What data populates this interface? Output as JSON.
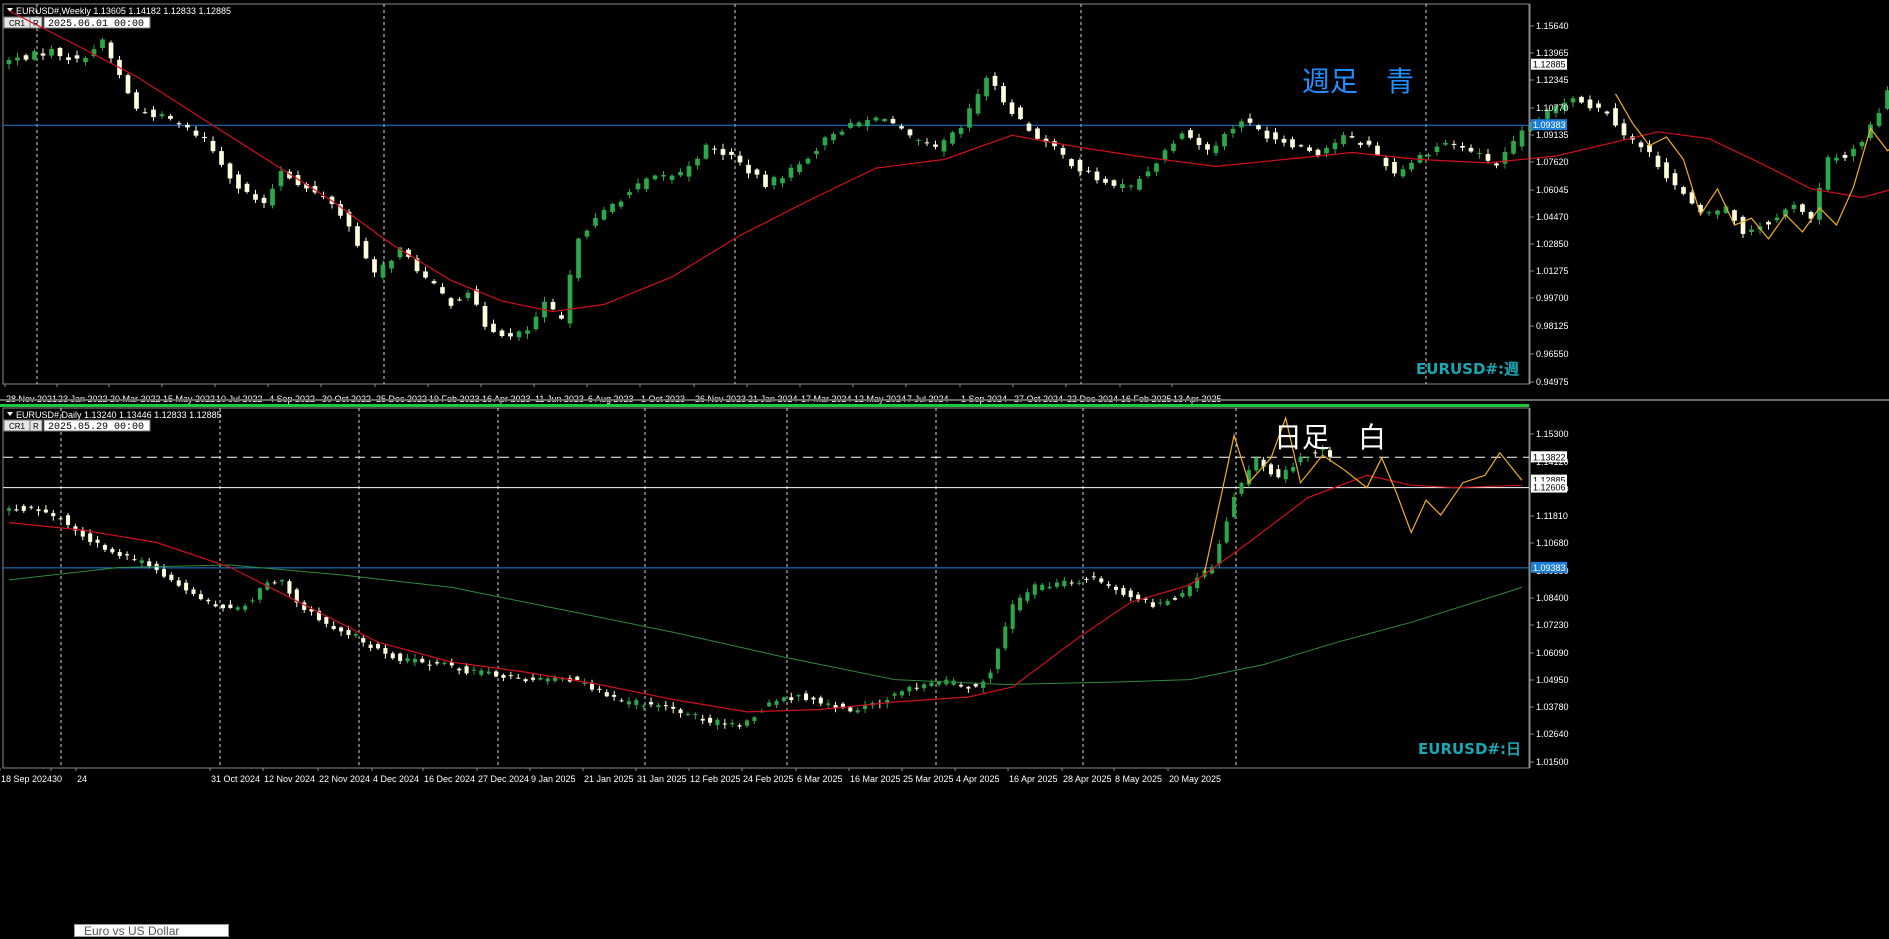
{
  "colors": {
    "background": "#000000",
    "bull_body": "#2ca84a",
    "bear_body": "#ffffe0",
    "ma_red": "#d0101a",
    "ma_green": "#2f8a3a",
    "zigzag": "#f0b020",
    "hline_blue": "#1e7fd8",
    "frame": "#8a8a8a",
    "annotation_blue": "#1e90ff",
    "watermark": "#1aa6b4",
    "active_border": "#1fc83a"
  },
  "panels": [
    {
      "header": {
        "symbol": "EURUSD#,Weekly",
        "ohlc": "1.13605 1.14182 1.12833 1.12885",
        "cr_label": "CR1",
        "r_label": "R",
        "datetime": "2025.06.01 00:00"
      },
      "annotation": "週足　青",
      "watermark": "EURUSD#:週",
      "price_ticks": [
        "1.15640",
        "1.13965",
        "1.12345",
        "1.10770",
        "1.09135",
        "1.07620",
        "1.06045",
        "1.04470",
        "1.02850",
        "1.01275",
        "0.99700",
        "0.98125",
        "0.96550",
        "0.94975"
      ],
      "time_ticks": [
        "28 Nov 2021",
        "23 Jan 2022",
        "20 Mar 2022",
        "15 May 2022",
        "10 Jul 2022",
        "4 Sep 2022",
        "30 Oct 2022",
        "25 Dec 2022",
        "19 Feb 2023",
        "16 Apr 2023",
        "11 Jun 2023",
        "6 Aug 2023",
        "1 Oct 2023",
        "26 Nov 2023",
        "21 Jan 2024",
        "17 Mar 2024",
        "12 May 2024",
        "7 Jul 2024",
        "1 Sep 2024",
        "27 Oct 2024",
        "22 Dec 2024",
        "16 Feb 2025",
        "13 Apr 2025"
      ],
      "price_labels": [
        {
          "text": "1.12885",
          "value": 1.12885,
          "style": "white"
        },
        {
          "text": "1.09383",
          "value": 1.09383,
          "style": "blue"
        }
      ],
      "hlines": [
        {
          "value": 1.09383,
          "style": "blue"
        }
      ]
    },
    {
      "header": {
        "symbol": "EURUSD#,Daily",
        "ohlc": "1.13240 1.13446 1.12833 1.12885",
        "cr_label": "CR1",
        "r_label": "R",
        "datetime": "2025.05.29 00:00"
      },
      "annotation": "日足　白",
      "watermark": "EURUSD#:日",
      "footer_label": "Euro vs US Dollar",
      "price_ticks": [
        "1.15300",
        "1.14120",
        "1.12940",
        "1.11810",
        "1.10680",
        "1.09550",
        "1.08400",
        "1.07230",
        "1.06090",
        "1.04950",
        "1.03780",
        "1.02640",
        "1.01500"
      ],
      "time_ticks": [
        "18 Sep 2024",
        "30",
        "24",
        "31 Oct 2024",
        "12 Nov 2024",
        "22 Nov 2024",
        "4 Dec 2024",
        "16 Dec 2024",
        "27 Dec 2024",
        "9 Jan 2025",
        "21 Jan 2025",
        "31 Jan 2025",
        "12 Feb 2025",
        "24 Feb 2025",
        "6 Mar 2025",
        "16 Mar 2025",
        "25 Mar 2025",
        "4 Apr 2025",
        "16 Apr 2025",
        "28 Apr 2025",
        "8 May 2025",
        "20 May 2025"
      ],
      "price_labels": [
        {
          "text": "1.13822",
          "value": 1.13822,
          "style": "white"
        },
        {
          "text": "1.12885",
          "value": 1.12885,
          "style": "white"
        },
        {
          "text": "1.12606",
          "value": 1.12606,
          "style": "white"
        },
        {
          "text": "1.09383",
          "value": 1.09383,
          "style": "blue"
        }
      ],
      "hlines": [
        {
          "value": 1.13822,
          "style": "white-dashed"
        },
        {
          "value": 1.12606,
          "style": "white"
        },
        {
          "value": 1.09383,
          "style": "blue"
        }
      ]
    }
  ],
  "chart_data": [
    {
      "type": "candlestick",
      "title": "EURUSD#,Weekly",
      "ylim": [
        0.944,
        1.164
      ],
      "x_start": "28 Nov 2021",
      "bar_count": 222,
      "grid": "vertical dashed",
      "close_path": [
        [
          0,
          1.13
        ],
        [
          6,
          1.137
        ],
        [
          9,
          1.131
        ],
        [
          12,
          1.142
        ],
        [
          16,
          1.103
        ],
        [
          20,
          1.097
        ],
        [
          24,
          1.086
        ],
        [
          28,
          1.058
        ],
        [
          31,
          1.047
        ],
        [
          33,
          1.068
        ],
        [
          36,
          1.057
        ],
        [
          39,
          1.049
        ],
        [
          41,
          1.035
        ],
        [
          44,
          1.007
        ],
        [
          47,
          1.022
        ],
        [
          50,
          1.005
        ],
        [
          53,
          0.991
        ],
        [
          55,
          0.998
        ],
        [
          57,
          0.978
        ],
        [
          60,
          0.971
        ],
        [
          62,
          0.975
        ],
        [
          64,
          0.99
        ],
        [
          66,
          0.981
        ],
        [
          68,
          1.03
        ],
        [
          72,
          1.048
        ],
        [
          76,
          1.062
        ],
        [
          80,
          1.066
        ],
        [
          83,
          1.081
        ],
        [
          86,
          1.076
        ],
        [
          90,
          1.059
        ],
        [
          94,
          1.071
        ],
        [
          98,
          1.09
        ],
        [
          101,
          1.095
        ],
        [
          104,
          1.099
        ],
        [
          107,
          1.086
        ],
        [
          110,
          1.08
        ],
        [
          113,
          1.092
        ],
        [
          116,
          1.122
        ],
        [
          118,
          1.108
        ],
        [
          121,
          1.091
        ],
        [
          124,
          1.08
        ],
        [
          127,
          1.068
        ],
        [
          130,
          1.06
        ],
        [
          133,
          1.058
        ],
        [
          136,
          1.073
        ],
        [
          139,
          1.091
        ],
        [
          142,
          1.079
        ],
        [
          146,
          1.097
        ],
        [
          149,
          1.088
        ],
        [
          152,
          1.083
        ],
        [
          155,
          1.078
        ],
        [
          158,
          1.087
        ],
        [
          161,
          1.082
        ],
        [
          164,
          1.066
        ],
        [
          167,
          1.076
        ],
        [
          170,
          1.084
        ],
        [
          173,
          1.079
        ],
        [
          176,
          1.071
        ],
        [
          179,
          1.089
        ],
        [
          182,
          1.101
        ],
        [
          185,
          1.111
        ],
        [
          187,
          1.105
        ],
        [
          189,
          1.102
        ],
        [
          191,
          1.089
        ],
        [
          194,
          1.077
        ],
        [
          197,
          1.059
        ],
        [
          200,
          1.042
        ],
        [
          203,
          1.046
        ],
        [
          205,
          1.032
        ],
        [
          207,
          1.036
        ],
        [
          209,
          1.04
        ],
        [
          211,
          1.049
        ],
        [
          213,
          1.039
        ],
        [
          215,
          1.074
        ],
        [
          217,
          1.076
        ],
        [
          219,
          1.085
        ],
        [
          221,
          1.102
        ],
        [
          223,
          1.128
        ],
        [
          225,
          1.147
        ],
        [
          227,
          1.133
        ],
        [
          229,
          1.125
        ],
        [
          231,
          1.129
        ]
      ],
      "ma_red": [
        [
          0,
          1.16
        ],
        [
          8,
          1.14
        ],
        [
          15,
          1.122
        ],
        [
          22,
          1.1
        ],
        [
          30,
          1.075
        ],
        [
          38,
          1.05
        ],
        [
          45,
          1.025
        ],
        [
          52,
          1.004
        ],
        [
          58,
          0.992
        ],
        [
          64,
          0.986
        ],
        [
          70,
          0.99
        ],
        [
          78,
          1.006
        ],
        [
          86,
          1.03
        ],
        [
          94,
          1.05
        ],
        [
          102,
          1.069
        ],
        [
          110,
          1.074
        ],
        [
          118,
          1.088
        ],
        [
          126,
          1.081
        ],
        [
          134,
          1.075
        ],
        [
          142,
          1.07
        ],
        [
          150,
          1.074
        ],
        [
          158,
          1.078
        ],
        [
          166,
          1.074
        ],
        [
          174,
          1.072
        ],
        [
          182,
          1.076
        ],
        [
          188,
          1.083
        ],
        [
          194,
          1.09
        ],
        [
          200,
          1.086
        ],
        [
          206,
          1.072
        ],
        [
          212,
          1.057
        ],
        [
          218,
          1.052
        ],
        [
          224,
          1.06
        ],
        [
          231,
          1.077
        ]
      ],
      "zigzag": [
        [
          189,
          1.112
        ],
        [
          191,
          1.095
        ],
        [
          193,
          1.082
        ],
        [
          195,
          1.087
        ],
        [
          197,
          1.074
        ],
        [
          199,
          1.042
        ],
        [
          201,
          1.057
        ],
        [
          203,
          1.036
        ],
        [
          205,
          1.04
        ],
        [
          207,
          1.028
        ],
        [
          209,
          1.042
        ],
        [
          211,
          1.032
        ],
        [
          213,
          1.046
        ],
        [
          215,
          1.036
        ],
        [
          217,
          1.058
        ],
        [
          219,
          1.092
        ],
        [
          221,
          1.079
        ],
        [
          223,
          1.086
        ],
        [
          225,
          1.122
        ],
        [
          227,
          1.14
        ],
        [
          229,
          1.117
        ],
        [
          231,
          1.103
        ]
      ]
    },
    {
      "type": "candlestick",
      "title": "EURUSD#,Daily",
      "ylim": [
        1.0135,
        1.158
      ],
      "x_start": "18 Sep 2024",
      "bar_count": 180,
      "grid": "vertical dashed",
      "close_path": [
        [
          0,
          1.117
        ],
        [
          4,
          1.118
        ],
        [
          8,
          1.114
        ],
        [
          12,
          1.105
        ],
        [
          16,
          1.099
        ],
        [
          20,
          1.095
        ],
        [
          24,
          1.087
        ],
        [
          28,
          1.08
        ],
        [
          32,
          1.077
        ],
        [
          36,
          1.087
        ],
        [
          38,
          1.088
        ],
        [
          40,
          1.08
        ],
        [
          44,
          1.071
        ],
        [
          48,
          1.066
        ],
        [
          52,
          1.059
        ],
        [
          56,
          1.056
        ],
        [
          60,
          1.055
        ],
        [
          64,
          1.052
        ],
        [
          68,
          1.051
        ],
        [
          72,
          1.049
        ],
        [
          76,
          1.05
        ],
        [
          80,
          1.046
        ],
        [
          84,
          1.04
        ],
        [
          88,
          1.039
        ],
        [
          92,
          1.036
        ],
        [
          96,
          1.032
        ],
        [
          100,
          1.031
        ],
        [
          104,
          1.039
        ],
        [
          108,
          1.043
        ],
        [
          112,
          1.039
        ],
        [
          116,
          1.036
        ],
        [
          120,
          1.042
        ],
        [
          124,
          1.046
        ],
        [
          128,
          1.048
        ],
        [
          132,
          1.046
        ],
        [
          134,
          1.052
        ],
        [
          137,
          1.078
        ],
        [
          140,
          1.086
        ],
        [
          144,
          1.088
        ],
        [
          148,
          1.09
        ],
        [
          152,
          1.084
        ],
        [
          156,
          1.079
        ],
        [
          160,
          1.083
        ],
        [
          164,
          1.095
        ],
        [
          167,
          1.123
        ],
        [
          170,
          1.138
        ],
        [
          173,
          1.13
        ],
        [
          176,
          1.138
        ],
        [
          179,
          1.142
        ],
        [
          182,
          1.133
        ],
        [
          185,
          1.128
        ],
        [
          188,
          1.132
        ],
        [
          191,
          1.117
        ],
        [
          194,
          1.119
        ],
        [
          197,
          1.126
        ],
        [
          200,
          1.13
        ],
        [
          203,
          1.133
        ],
        [
          205,
          1.129
        ]
      ],
      "ma_red": [
        [
          0,
          1.112
        ],
        [
          10,
          1.109
        ],
        [
          20,
          1.104
        ],
        [
          30,
          1.094
        ],
        [
          40,
          1.079
        ],
        [
          50,
          1.064
        ],
        [
          60,
          1.056
        ],
        [
          70,
          1.052
        ],
        [
          80,
          1.047
        ],
        [
          90,
          1.041
        ],
        [
          100,
          1.036
        ],
        [
          110,
          1.037
        ],
        [
          120,
          1.04
        ],
        [
          130,
          1.042
        ],
        [
          136,
          1.046
        ],
        [
          145,
          1.066
        ],
        [
          152,
          1.08
        ],
        [
          160,
          1.087
        ],
        [
          168,
          1.104
        ],
        [
          176,
          1.122
        ],
        [
          184,
          1.131
        ],
        [
          190,
          1.127
        ],
        [
          196,
          1.126
        ],
        [
          205,
          1.127
        ]
      ],
      "ma_green": [
        [
          0,
          1.089
        ],
        [
          15,
          1.094
        ],
        [
          30,
          1.095
        ],
        [
          45,
          1.091
        ],
        [
          60,
          1.086
        ],
        [
          75,
          1.077
        ],
        [
          90,
          1.068
        ],
        [
          105,
          1.058
        ],
        [
          120,
          1.049
        ],
        [
          135,
          1.047
        ],
        [
          150,
          1.048
        ],
        [
          160,
          1.049
        ],
        [
          170,
          1.055
        ],
        [
          180,
          1.064
        ],
        [
          190,
          1.072
        ],
        [
          205,
          1.086
        ]
      ],
      "zigzag": [
        [
          162,
          1.092
        ],
        [
          166,
          1.147
        ],
        [
          168,
          1.128
        ],
        [
          171,
          1.138
        ],
        [
          173,
          1.154
        ],
        [
          175,
          1.128
        ],
        [
          178,
          1.139
        ],
        [
          181,
          1.133
        ],
        [
          184,
          1.126
        ],
        [
          186,
          1.138
        ],
        [
          188,
          1.124
        ],
        [
          190,
          1.108
        ],
        [
          192,
          1.121
        ],
        [
          194,
          1.115
        ],
        [
          197,
          1.128
        ],
        [
          200,
          1.131
        ],
        [
          202,
          1.14
        ],
        [
          205,
          1.129
        ]
      ]
    }
  ]
}
